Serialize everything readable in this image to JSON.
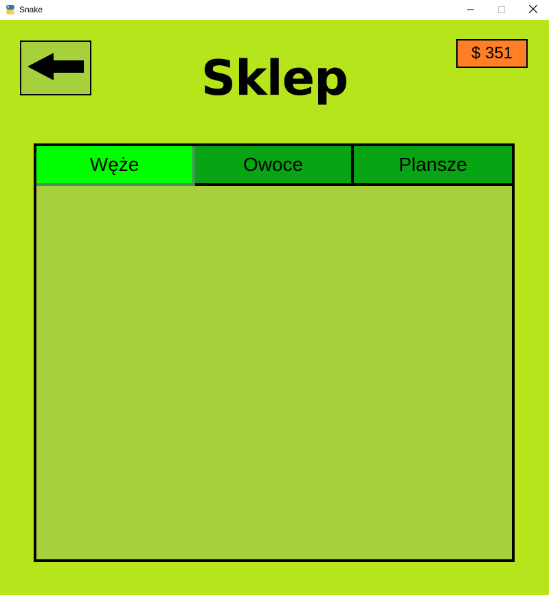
{
  "window": {
    "title": "Snake",
    "app_icon": "python-icon",
    "controls": [
      "minimize-icon",
      "maximize-icon",
      "close-icon"
    ]
  },
  "header": {
    "title": "Sklep",
    "back_icon": "arrow-left-icon",
    "money": "$ 351"
  },
  "tabs": [
    {
      "label": "Węże",
      "active": true
    },
    {
      "label": "Owoce",
      "active": false
    },
    {
      "label": "Plansze",
      "active": false
    }
  ],
  "colors": {
    "background": "#b7e51b",
    "panel": "#a6d13d",
    "tab_active": "#00ff00",
    "tab_inactive": "#07a513",
    "money_badge": "#ff7f27"
  }
}
